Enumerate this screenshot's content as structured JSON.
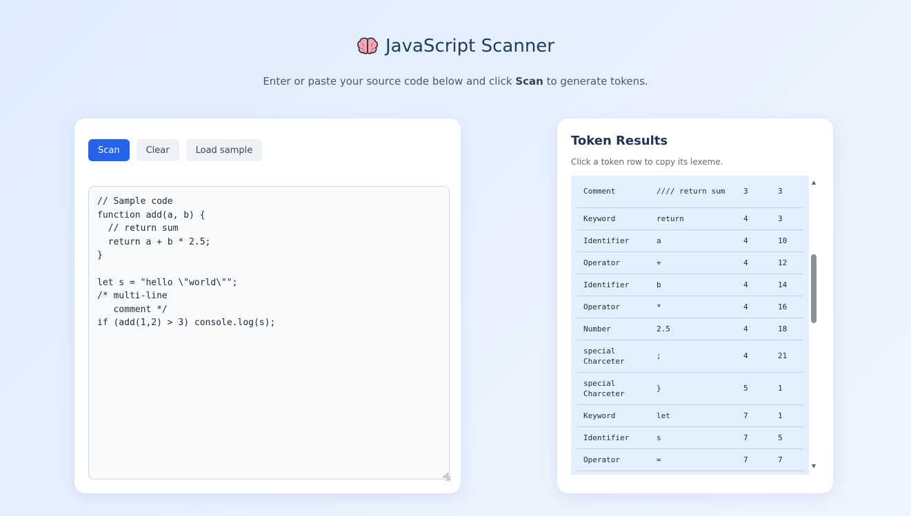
{
  "header": {
    "title": "JavaScript Scanner",
    "subtitle_pre": "Enter or paste your source code below and click ",
    "subtitle_bold": "Scan",
    "subtitle_post": " to generate tokens."
  },
  "toolbar": {
    "scan_label": "Scan",
    "clear_label": "Clear",
    "load_sample_label": "Load sample"
  },
  "editor": {
    "code": "// Sample code\nfunction add(a, b) {\n  // return sum\n  return a + b * 2.5;\n}\n\nlet s = \"hello \\\"world\\\"\";\n/* multi-line\n   comment */\nif (add(1,2) > 3) console.log(s);"
  },
  "results": {
    "title": "Token Results",
    "hint": "Click a token row to copy its lexeme.",
    "rows": [
      {
        "type": "Comment",
        "lexeme": "//// return sum",
        "line": "3",
        "col": "3"
      },
      {
        "type": "Keyword",
        "lexeme": "return",
        "line": "4",
        "col": "3"
      },
      {
        "type": "Identifier",
        "lexeme": "a",
        "line": "4",
        "col": "10"
      },
      {
        "type": "Operator",
        "lexeme": "+",
        "line": "4",
        "col": "12"
      },
      {
        "type": "Identifier",
        "lexeme": "b",
        "line": "4",
        "col": "14"
      },
      {
        "type": "Operator",
        "lexeme": "*",
        "line": "4",
        "col": "16"
      },
      {
        "type": "Number",
        "lexeme": "2.5",
        "line": "4",
        "col": "18"
      },
      {
        "type": "special Charceter",
        "lexeme": ";",
        "line": "4",
        "col": "21"
      },
      {
        "type": "special Charceter",
        "lexeme": "}",
        "line": "5",
        "col": "1"
      },
      {
        "type": "Keyword",
        "lexeme": "let",
        "line": "7",
        "col": "1"
      },
      {
        "type": "Identifier",
        "lexeme": "s",
        "line": "7",
        "col": "5"
      },
      {
        "type": "Operator",
        "lexeme": "=",
        "line": "7",
        "col": "7"
      }
    ]
  },
  "icons": {
    "brain": "brain-icon",
    "scroll_up": "scroll-up-arrow-icon",
    "scroll_down": "scroll-down-arrow-icon"
  },
  "colors": {
    "primary": "#2563eb",
    "title": "#203a6a",
    "table_row_bg": "#e2f0fd"
  }
}
